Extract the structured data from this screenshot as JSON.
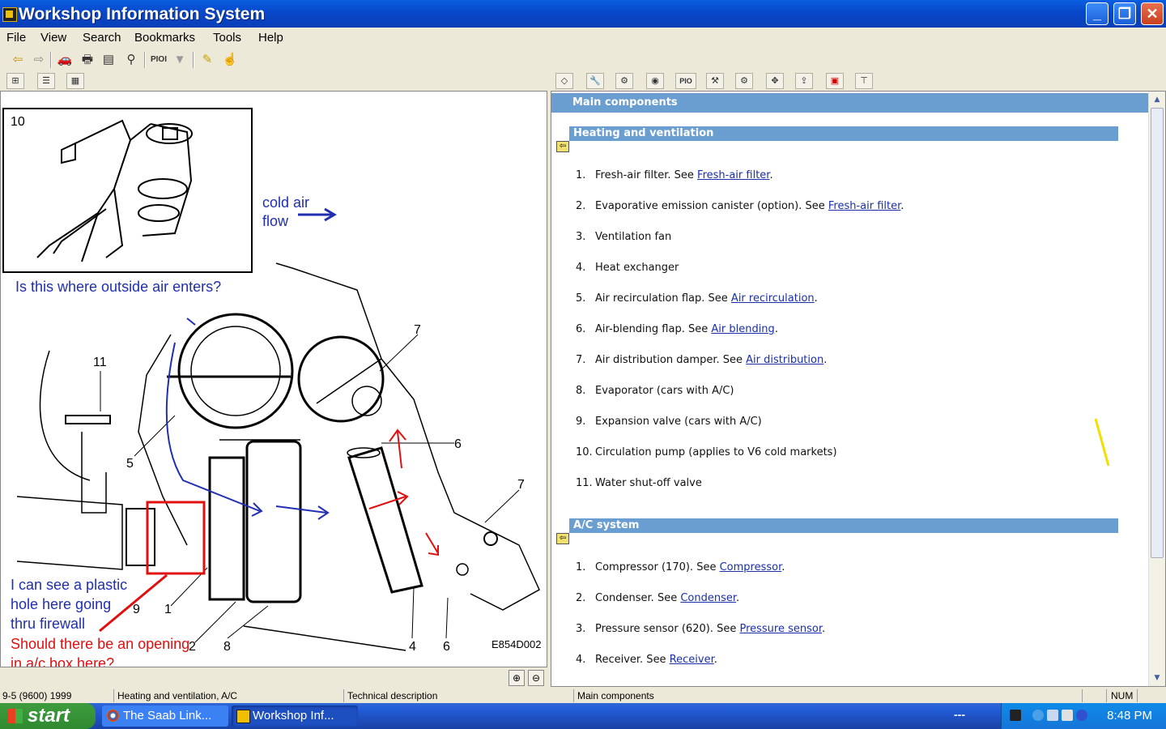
{
  "window": {
    "title": "Workshop Information System"
  },
  "menu": [
    "File",
    "View",
    "Search",
    "Bookmarks",
    "Tools",
    "Help"
  ],
  "right_toolbar": {
    "pio_label": "PIO"
  },
  "main_toolbar": {
    "pio_label": "PIOI"
  },
  "diagram": {
    "figure_code": "E854D002",
    "inset_label": "10",
    "callouts": [
      "11",
      "5",
      "9",
      "1",
      "2",
      "8",
      "4",
      "6",
      "6",
      "7",
      "7"
    ],
    "annotations": {
      "cold_air_line1": "cold air",
      "cold_air_line2": "flow",
      "question_outside": "Is this where outside air enters?",
      "plastic_line1": "I can see a plastic",
      "plastic_line2": "hole here going",
      "plastic_line3": "thru firewall",
      "opening_line1": "Should there be an opening",
      "opening_line2": "in a/c box here?"
    },
    "annotation_colors": {
      "blue": "#1f2fb0",
      "red": "#e01010"
    }
  },
  "document": {
    "header": "Main components",
    "sections": [
      {
        "title": "Heating and ventilation",
        "items": [
          {
            "num": "1.",
            "text": "Fresh-air filter. See ",
            "link": "Fresh-air filter",
            "after": "."
          },
          {
            "num": "2.",
            "text": "Evaporative emission canister (option). See ",
            "link": "Fresh-air filter",
            "after": "."
          },
          {
            "num": "3.",
            "text": "Ventilation fan"
          },
          {
            "num": "4.",
            "text": "Heat exchanger"
          },
          {
            "num": "5.",
            "text": "Air recirculation flap. See ",
            "link": "Air recirculation",
            "after": "."
          },
          {
            "num": "6.",
            "text": "Air-blending flap. See ",
            "link": "Air blending",
            "after": "."
          },
          {
            "num": "7.",
            "text": "Air distribution damper. See ",
            "link": "Air distribution",
            "after": "."
          },
          {
            "num": "8.",
            "text": "Evaporator (cars with A/C)"
          },
          {
            "num": "9.",
            "text": "Expansion valve (cars with A/C)"
          },
          {
            "num": "10.",
            "text": "Circulation pump (applies to V6 cold markets)"
          },
          {
            "num": "11.",
            "text": "Water shut-off valve"
          }
        ]
      },
      {
        "title": "A/C system",
        "items": [
          {
            "num": "1.",
            "text": "Compressor (170). See ",
            "link": "Compressor",
            "after": "."
          },
          {
            "num": "2.",
            "text": "Condenser. See ",
            "link": "Condenser",
            "after": "."
          },
          {
            "num": "3.",
            "text": "Pressure sensor (620). See ",
            "link": "Pressure sensor",
            "after": "."
          },
          {
            "num": "4.",
            "text": "Receiver. See ",
            "link": "Receiver",
            "after": "."
          }
        ]
      }
    ]
  },
  "status": {
    "model": "9-5 (9600) 1999",
    "section": "Heating and ventilation, A/C",
    "doc_type": "Technical description",
    "doc_title": "Main components",
    "num": "NUM"
  },
  "taskbar": {
    "start": "start",
    "tasks": [
      "The Saab Link...",
      "Workshop Inf..."
    ],
    "tray_dashes": "---",
    "clock": "8:48 PM"
  }
}
